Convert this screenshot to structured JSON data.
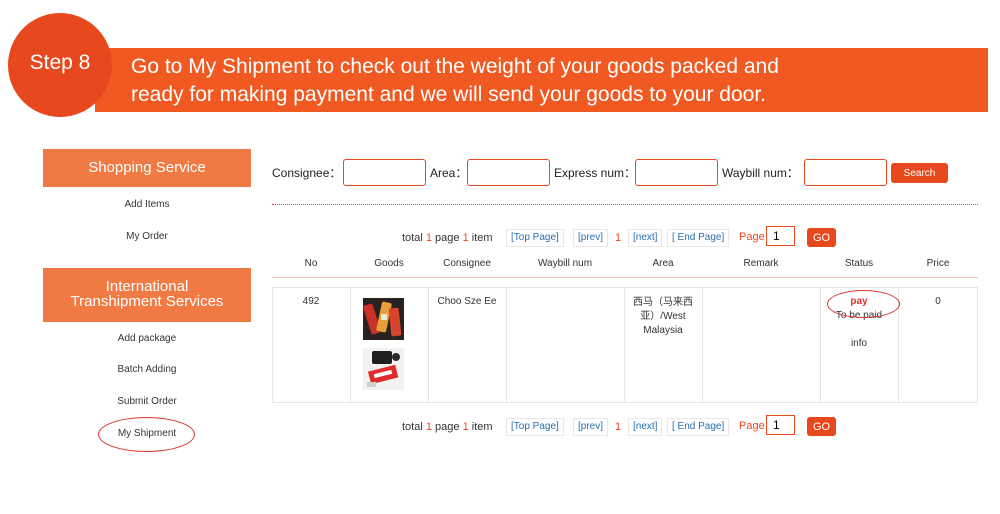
{
  "banner": {
    "step": "Step 8",
    "line1": "Go to My Shipment to check out the weight of your goods packed and",
    "line2": "ready for making payment and we will send your goods to your door."
  },
  "sidebar": {
    "section1": "Shopping Service",
    "items1": [
      "Add Items",
      "My Order"
    ],
    "section2_line1": "International",
    "section2_line2": "Transhipment Services",
    "items2": [
      "Add package",
      "Batch Adding",
      "Submit Order",
      "My Shipment"
    ]
  },
  "search": {
    "consignee_label": "Consignee：",
    "area_label": "Area：",
    "express_label": "Express num：",
    "waybill_label": "Waybill num：",
    "button": "Search"
  },
  "pager": {
    "total_prefix": "total",
    "total_pages": "1",
    "page_word": "page",
    "total_items": "1",
    "item_word": "item",
    "top_page": "[Top Page]",
    "prev": "[prev]",
    "current": "1",
    "next": "[next]",
    "end_page": "[ End Page]",
    "page_label": "Page",
    "page_input": "1",
    "go": "GO"
  },
  "table": {
    "columns": [
      "No",
      "Goods",
      "Consignee",
      "Waybill num",
      "Area",
      "Remark",
      "Status",
      "Price"
    ],
    "rows": [
      {
        "no": "492",
        "consignee": "Choo Sze Ee",
        "waybill": "",
        "area_line1": "西马（马来西",
        "area_line2": "亚）/West",
        "area_line3": "Malaysia",
        "remark": "",
        "status_action": "pay",
        "status_text": "To be paid",
        "status_info": "info",
        "price": "0"
      }
    ]
  },
  "colors": {
    "accent": "#e8481e",
    "sidebar_header": "#f07a43",
    "link": "#2a6db3"
  },
  "icons": [
    "product-photo-1",
    "product-photo-2"
  ]
}
